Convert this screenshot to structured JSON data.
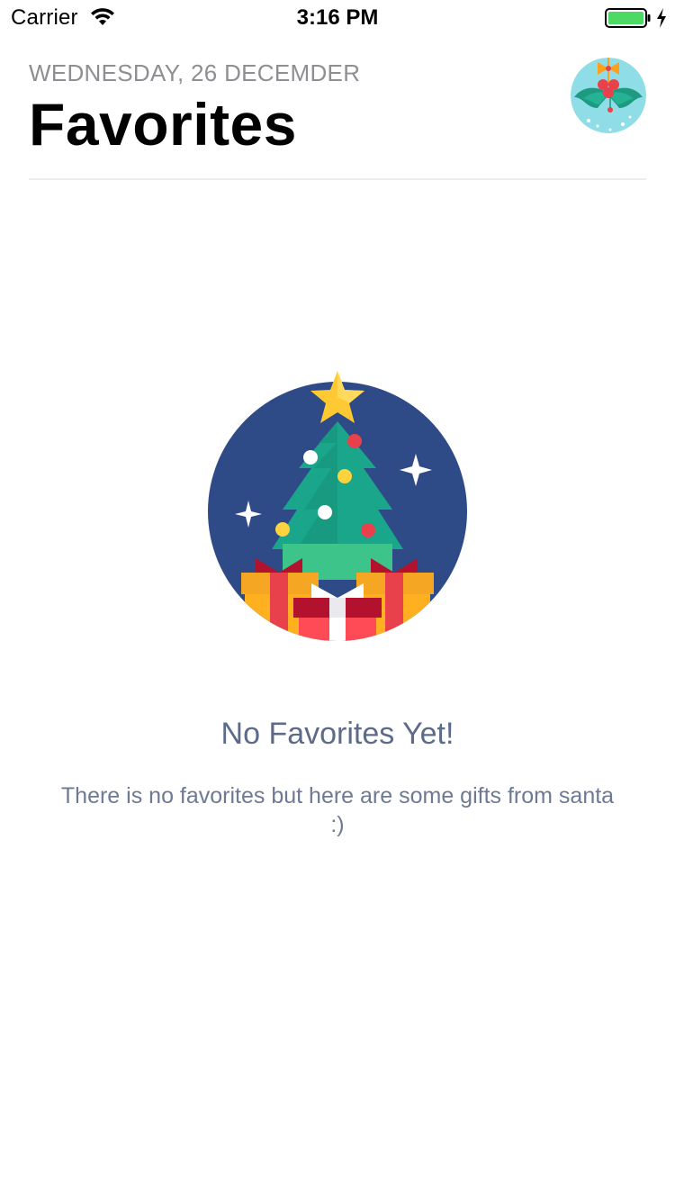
{
  "status_bar": {
    "carrier": "Carrier",
    "time": "3:16 PM",
    "icons": [
      "wifi-icon",
      "battery-icon",
      "charging-icon"
    ],
    "battery_color": "#4cd964"
  },
  "header": {
    "date": "WEDNESDAY, 26 DECEMDER",
    "title": "Favorites",
    "avatar_icon": "holly-mistletoe-avatar"
  },
  "empty_state": {
    "illustration_icon": "christmas-tree-gifts-icon",
    "title": "No Favorites Yet!",
    "description": "There is no favorites but here are some gifts from santa :)"
  },
  "colors": {
    "title_text": "#000000",
    "date_text": "#8e8e93",
    "empty_title": "#5d6b89",
    "empty_desc": "#6e7a94",
    "illustration_bg": "#2e4a87",
    "tree_green": "#1aa68a",
    "star_yellow": "#ffc933",
    "gift_red": "#e8414b",
    "gift_orange": "#f5a623",
    "avatar_bg": "#8fdde6"
  }
}
